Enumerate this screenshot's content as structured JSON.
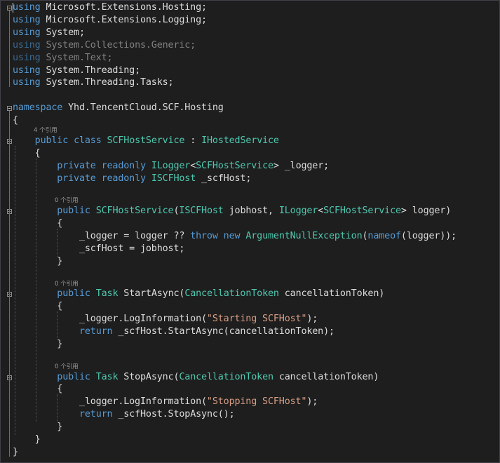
{
  "editor": {
    "lines": [
      {
        "row": 0,
        "segments": [
          {
            "t": "using",
            "c": "kw"
          },
          {
            "t": " Microsoft.Extensions.Hosting;",
            "c": "pl"
          }
        ]
      },
      {
        "row": 1,
        "segments": [
          {
            "t": "using",
            "c": "kw"
          },
          {
            "t": " Microsoft.Extensions.Logging;",
            "c": "pl"
          }
        ]
      },
      {
        "row": 2,
        "segments": [
          {
            "t": "using",
            "c": "kw"
          },
          {
            "t": " System;",
            "c": "pl"
          }
        ]
      },
      {
        "row": 3,
        "segments": [
          {
            "t": "using",
            "c": "dimkw"
          },
          {
            "t": " System.Collections.Generic;",
            "c": "dim"
          }
        ]
      },
      {
        "row": 4,
        "segments": [
          {
            "t": "using",
            "c": "dimkw"
          },
          {
            "t": " System.Text;",
            "c": "dim"
          }
        ]
      },
      {
        "row": 5,
        "segments": [
          {
            "t": "using",
            "c": "kw"
          },
          {
            "t": " System.Threading;",
            "c": "pl"
          }
        ]
      },
      {
        "row": 6,
        "segments": [
          {
            "t": "using",
            "c": "kw"
          },
          {
            "t": " System.Threading.Tasks;",
            "c": "pl"
          }
        ]
      },
      {
        "row": 8,
        "segments": [
          {
            "t": "namespace",
            "c": "kw"
          },
          {
            "t": " Yhd.TencentCloud.SCF.Hosting",
            "c": "pl"
          }
        ]
      },
      {
        "row": 9,
        "segments": [
          {
            "t": "{",
            "c": "pl"
          }
        ]
      },
      {
        "row": 10,
        "segments": [
          {
            "t": "    ",
            "c": "pl"
          },
          {
            "t": "public",
            "c": "kw"
          },
          {
            "t": " ",
            "c": "pl"
          },
          {
            "t": "class",
            "c": "kw"
          },
          {
            "t": " ",
            "c": "pl"
          },
          {
            "t": "SCFHostService",
            "c": "ty"
          },
          {
            "t": " : ",
            "c": "pl"
          },
          {
            "t": "IHostedService",
            "c": "ty"
          }
        ]
      },
      {
        "row": 11,
        "segments": [
          {
            "t": "    {",
            "c": "pl"
          }
        ]
      },
      {
        "row": 12,
        "segments": [
          {
            "t": "        ",
            "c": "pl"
          },
          {
            "t": "private",
            "c": "kw"
          },
          {
            "t": " ",
            "c": "pl"
          },
          {
            "t": "readonly",
            "c": "kw"
          },
          {
            "t": " ",
            "c": "pl"
          },
          {
            "t": "ILogger",
            "c": "ty"
          },
          {
            "t": "<",
            "c": "pl"
          },
          {
            "t": "SCFHostService",
            "c": "ty"
          },
          {
            "t": "> _logger;",
            "c": "pl"
          }
        ]
      },
      {
        "row": 13,
        "segments": [
          {
            "t": "        ",
            "c": "pl"
          },
          {
            "t": "private",
            "c": "kw"
          },
          {
            "t": " ",
            "c": "pl"
          },
          {
            "t": "readonly",
            "c": "kw"
          },
          {
            "t": " ",
            "c": "pl"
          },
          {
            "t": "ISCFHost",
            "c": "ty"
          },
          {
            "t": " _scfHost;",
            "c": "pl"
          }
        ]
      },
      {
        "row": 15,
        "segments": [
          {
            "t": "        ",
            "c": "pl"
          },
          {
            "t": "public",
            "c": "kw"
          },
          {
            "t": " ",
            "c": "pl"
          },
          {
            "t": "SCFHostService",
            "c": "ty"
          },
          {
            "t": "(",
            "c": "pl"
          },
          {
            "t": "ISCFHost",
            "c": "ty"
          },
          {
            "t": " jobhost, ",
            "c": "pl"
          },
          {
            "t": "ILogger",
            "c": "ty"
          },
          {
            "t": "<",
            "c": "pl"
          },
          {
            "t": "SCFHostService",
            "c": "ty"
          },
          {
            "t": "> logger)",
            "c": "pl"
          }
        ]
      },
      {
        "row": 16,
        "segments": [
          {
            "t": "        {",
            "c": "pl"
          }
        ]
      },
      {
        "row": 17,
        "segments": [
          {
            "t": "            _logger = logger ?? ",
            "c": "pl"
          },
          {
            "t": "throw",
            "c": "kw"
          },
          {
            "t": " ",
            "c": "pl"
          },
          {
            "t": "new",
            "c": "kw"
          },
          {
            "t": " ",
            "c": "pl"
          },
          {
            "t": "ArgumentNullException",
            "c": "ty"
          },
          {
            "t": "(",
            "c": "pl"
          },
          {
            "t": "nameof",
            "c": "kw"
          },
          {
            "t": "(logger));",
            "c": "pl"
          }
        ]
      },
      {
        "row": 18,
        "segments": [
          {
            "t": "            _scfHost = jobhost;",
            "c": "pl"
          }
        ]
      },
      {
        "row": 19,
        "segments": [
          {
            "t": "        }",
            "c": "pl"
          }
        ]
      },
      {
        "row": 21,
        "segments": [
          {
            "t": "        ",
            "c": "pl"
          },
          {
            "t": "public",
            "c": "kw"
          },
          {
            "t": " ",
            "c": "pl"
          },
          {
            "t": "Task",
            "c": "ty"
          },
          {
            "t": " StartAsync(",
            "c": "pl"
          },
          {
            "t": "CancellationToken",
            "c": "ty"
          },
          {
            "t": " cancellationToken)",
            "c": "pl"
          }
        ]
      },
      {
        "row": 22,
        "segments": [
          {
            "t": "        {",
            "c": "pl"
          }
        ]
      },
      {
        "row": 23,
        "segments": [
          {
            "t": "            _logger.LogInformation(",
            "c": "pl"
          },
          {
            "t": "\"Starting SCFHost\"",
            "c": "str"
          },
          {
            "t": ");",
            "c": "pl"
          }
        ]
      },
      {
        "row": 24,
        "segments": [
          {
            "t": "            ",
            "c": "pl"
          },
          {
            "t": "return",
            "c": "kw"
          },
          {
            "t": " _scfHost.StartAsync(cancellationToken);",
            "c": "pl"
          }
        ]
      },
      {
        "row": 25,
        "segments": [
          {
            "t": "        }",
            "c": "pl"
          }
        ]
      },
      {
        "row": 27,
        "segments": [
          {
            "t": "        ",
            "c": "pl"
          },
          {
            "t": "public",
            "c": "kw"
          },
          {
            "t": " ",
            "c": "pl"
          },
          {
            "t": "Task",
            "c": "ty"
          },
          {
            "t": " StopAsync(",
            "c": "pl"
          },
          {
            "t": "CancellationToken",
            "c": "ty"
          },
          {
            "t": " cancellationToken)",
            "c": "pl"
          }
        ]
      },
      {
        "row": 28,
        "segments": [
          {
            "t": "        {",
            "c": "pl"
          }
        ]
      },
      {
        "row": 29,
        "segments": [
          {
            "t": "            _logger.LogInformation(",
            "c": "pl"
          },
          {
            "t": "\"Stopping SCFHost\"",
            "c": "str"
          },
          {
            "t": ");",
            "c": "pl"
          }
        ]
      },
      {
        "row": 30,
        "segments": [
          {
            "t": "            ",
            "c": "pl"
          },
          {
            "t": "return",
            "c": "kw"
          },
          {
            "t": " _scfHost.StopAsync();",
            "c": "pl"
          }
        ]
      },
      {
        "row": 31,
        "segments": [
          {
            "t": "        }",
            "c": "pl"
          }
        ]
      },
      {
        "row": 32,
        "segments": [
          {
            "t": "    }",
            "c": "pl"
          }
        ]
      },
      {
        "row": 33,
        "segments": [
          {
            "t": "}",
            "c": "pl"
          }
        ]
      }
    ],
    "codelens": [
      {
        "before_row": 10,
        "text": "4 个引用",
        "indent": 1
      },
      {
        "before_row": 15,
        "text": "0 个引用",
        "indent": 2
      },
      {
        "before_row": 21,
        "text": "0 个引用",
        "indent": 2
      },
      {
        "before_row": 27,
        "text": "0 个引用",
        "indent": 2
      }
    ]
  },
  "colors": {
    "background": "#1e1e1e",
    "keyword": "#569cd6",
    "type": "#4ec9b0",
    "string": "#d69d85",
    "plain": "#dcdcdc",
    "unused": "#808080"
  }
}
